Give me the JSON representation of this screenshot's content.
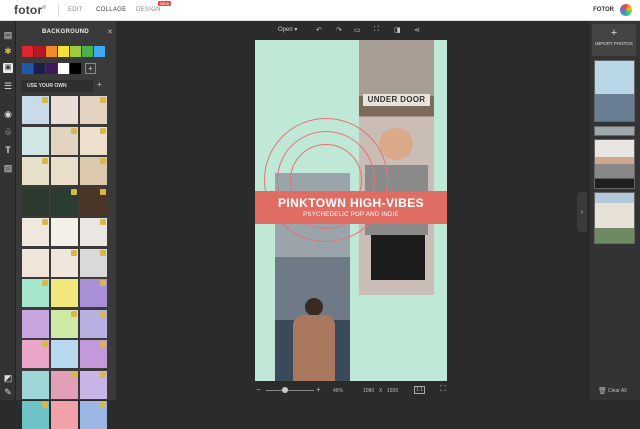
{
  "header": {
    "logo": "fotor",
    "logo_mark": "®",
    "nav": [
      "EDIT",
      "COLLAGE",
      "DESIGN"
    ],
    "new_badge": "NEW",
    "brand": "FOTOR"
  },
  "panel": {
    "title": "BACKGROUND",
    "use_your_own": "USE YOUR OWN",
    "swatches_row1": [
      "#e0262d",
      "#b31924",
      "#f08a2b",
      "#f4e133",
      "#9ccb3b",
      "#4caf50",
      "#3fa9f5"
    ],
    "swatches_row2": [
      "#1e5aa8",
      "#1b1f4a",
      "#3d1a5b",
      "#ffffff",
      "#000000"
    ]
  },
  "toolbar": {
    "open": "Open",
    "open_caret": "▾"
  },
  "canvas": {
    "door_text": "UNDER DOOR",
    "headline": "PINKTOWN HIGH-VIBES",
    "subhead": "PSYCHEDELIC POP AND INDIE"
  },
  "bottom": {
    "zoom": "46%",
    "width": "1080",
    "times": "X",
    "height": "1920",
    "ratio": "1:1"
  },
  "right": {
    "import_plus": "+",
    "import_label": "IMPORT PHOTOS",
    "clear_all": "Clear All"
  }
}
